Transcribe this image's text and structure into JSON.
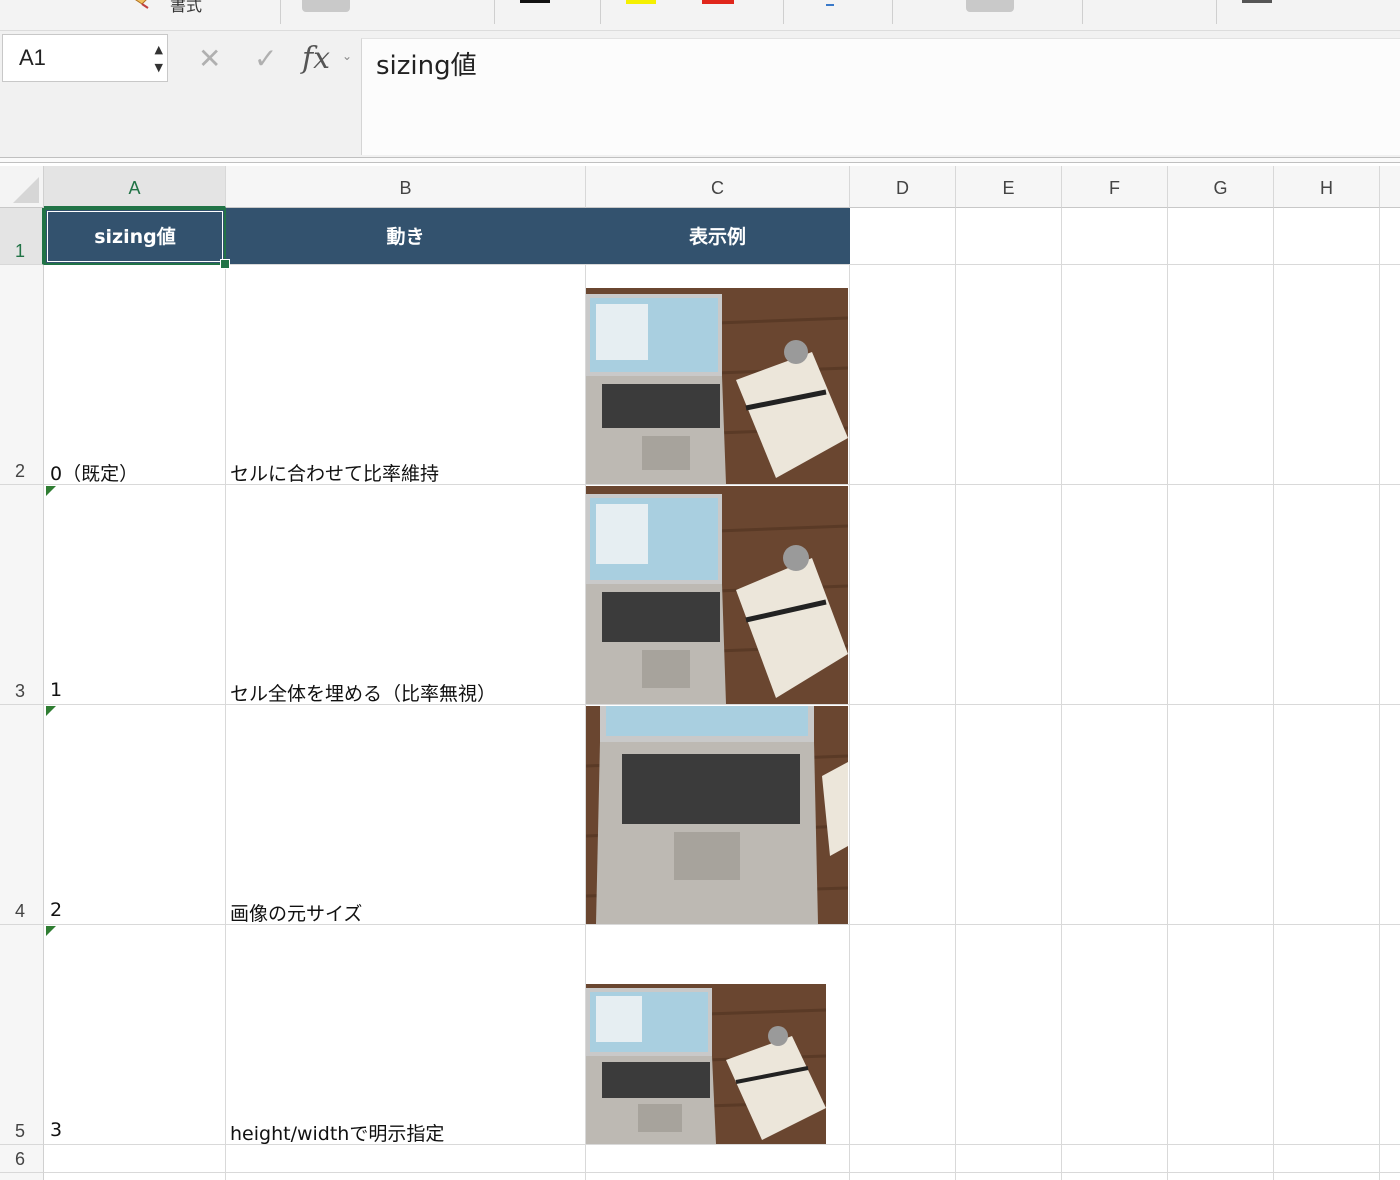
{
  "ribbon": {
    "format_label": "書式"
  },
  "formula_bar": {
    "name_box": "A1",
    "cancel_glyph": "✕",
    "enter_glyph": "✓",
    "fx_label": "fx",
    "content": "sizing値"
  },
  "columns": [
    "A",
    "B",
    "C",
    "D",
    "E",
    "F",
    "G",
    "H"
  ],
  "rows": [
    "1",
    "2",
    "3",
    "4",
    "5",
    "6"
  ],
  "table": {
    "header": [
      "sizing値",
      "動き",
      "表示例"
    ],
    "rows": [
      {
        "sizing": "0（既定）",
        "behavior": "セルに合わせて比率維持",
        "image": "laptop-photo"
      },
      {
        "sizing": "1",
        "behavior": "セル全体を埋める（比率無視）",
        "image": "laptop-photo"
      },
      {
        "sizing": "2",
        "behavior": "画像の元サイズ",
        "image": "laptop-photo"
      },
      {
        "sizing": "3",
        "behavior": "height/widthで明示指定",
        "image": "laptop-photo"
      }
    ]
  },
  "colors": {
    "header_fill": "#33526e",
    "selection": "#217346",
    "error_indicator": "#2f7d32"
  }
}
